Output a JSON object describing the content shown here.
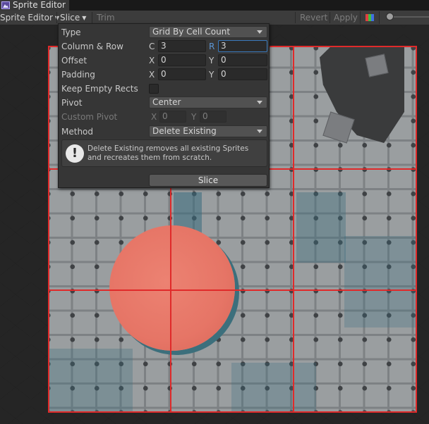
{
  "window": {
    "tab_title": "Sprite Editor",
    "tab_icon": "sprite-editor-icon"
  },
  "toolbar": {
    "mode_label": "Sprite Editor",
    "slice_label": "Slice",
    "trim_label": "Trim",
    "revert_label": "Revert",
    "apply_label": "Apply",
    "color_toggle_icon": "rgb-channels-icon"
  },
  "slice_popup": {
    "type_label": "Type",
    "type_value": "Grid By Cell Count",
    "column_row_label": "Column & Row",
    "column_axis": "C",
    "column_value": "3",
    "row_axis": "R",
    "row_value": "3",
    "offset_label": "Offset",
    "offset_x_axis": "X",
    "offset_x": "0",
    "offset_y_axis": "Y",
    "offset_y": "0",
    "padding_label": "Padding",
    "padding_x_axis": "X",
    "padding_x": "0",
    "padding_y_axis": "Y",
    "padding_y": "0",
    "keep_empty_label": "Keep Empty Rects",
    "keep_empty_checked": false,
    "pivot_label": "Pivot",
    "pivot_value": "Center",
    "custom_pivot_label": "Custom Pivot",
    "custom_pivot_x_axis": "X",
    "custom_pivot_x": "0",
    "custom_pivot_y_axis": "Y",
    "custom_pivot_y": "0",
    "method_label": "Method",
    "method_value": "Delete Existing",
    "help_text": "Delete Existing removes all existing Sprites and recreates them from scratch.",
    "help_icon": "info-icon",
    "slice_button_label": "Slice"
  },
  "colors": {
    "grid_line": "#e02a2a",
    "accent_focus": "#3a79bb",
    "sprite_circle": "#e67566"
  }
}
